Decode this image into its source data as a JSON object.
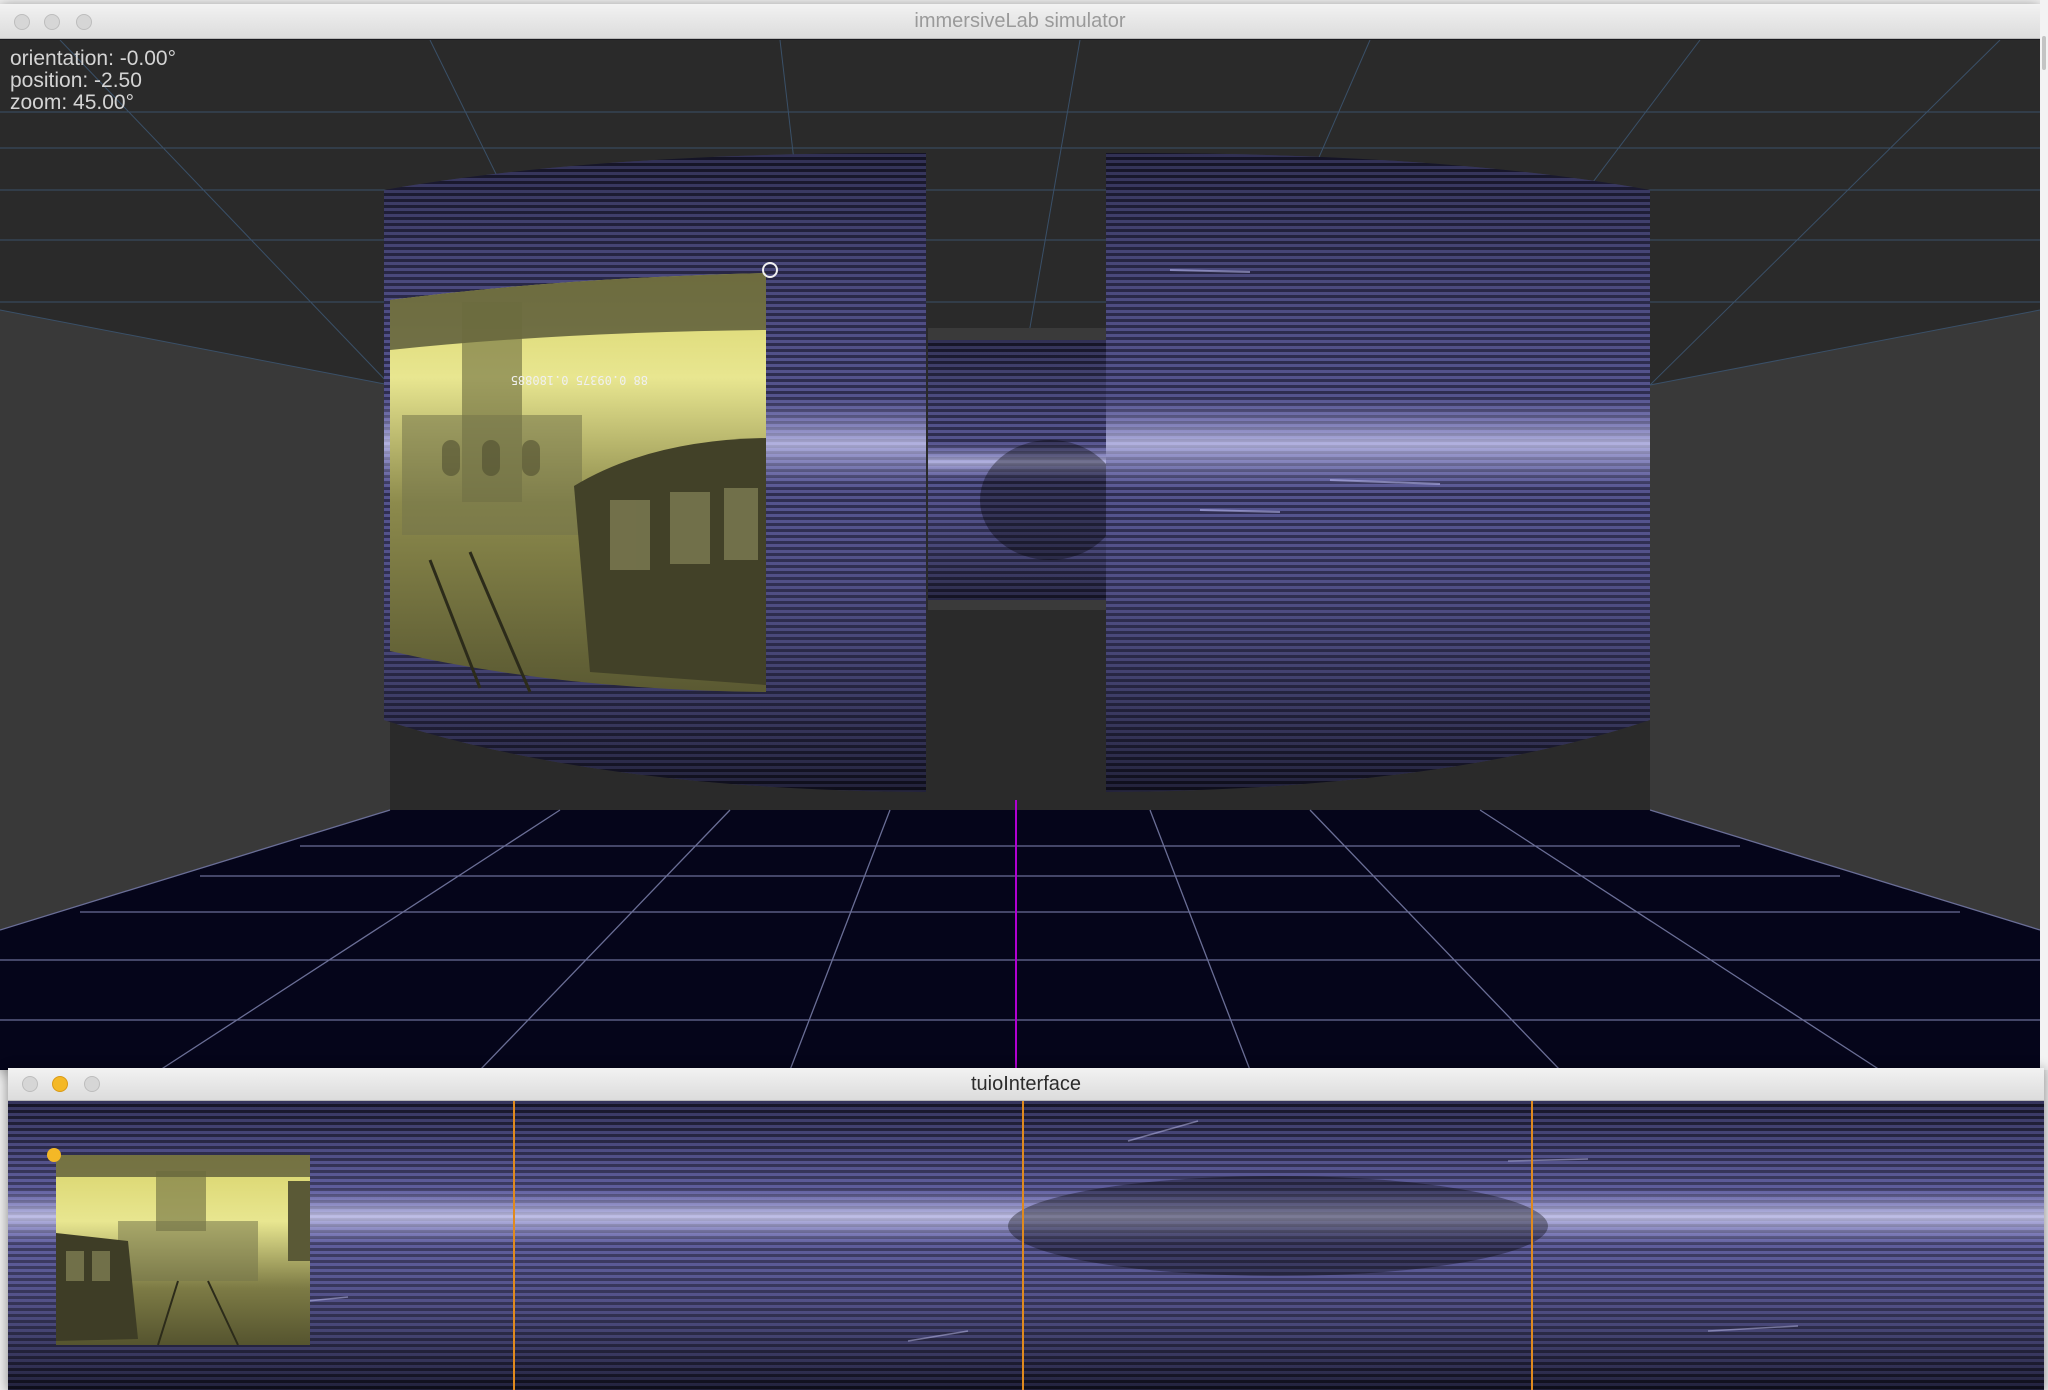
{
  "simulator": {
    "window_title": "immersiveLab simulator",
    "hud": {
      "orientation": "orientation: -0.00°",
      "position": "position: -2.50",
      "zoom": "zoom: 45.00°"
    }
  },
  "tuio": {
    "window_title": "tuioInterface"
  },
  "colors": {
    "background_gray": "#2b2b2b",
    "floor": "#06061a",
    "grid_line": "#5e6288",
    "screen_band": "#3c3a68",
    "screen_highlight": "#cfd0ff",
    "video_tint": "#d7d46a",
    "divider_orange": "#e08a1e",
    "cursor_orange": "#f4b826",
    "center_axis": "#b000d0"
  },
  "icons": [
    "close-icon",
    "minimize-icon",
    "zoom-icon",
    "media-handle-icon"
  ]
}
